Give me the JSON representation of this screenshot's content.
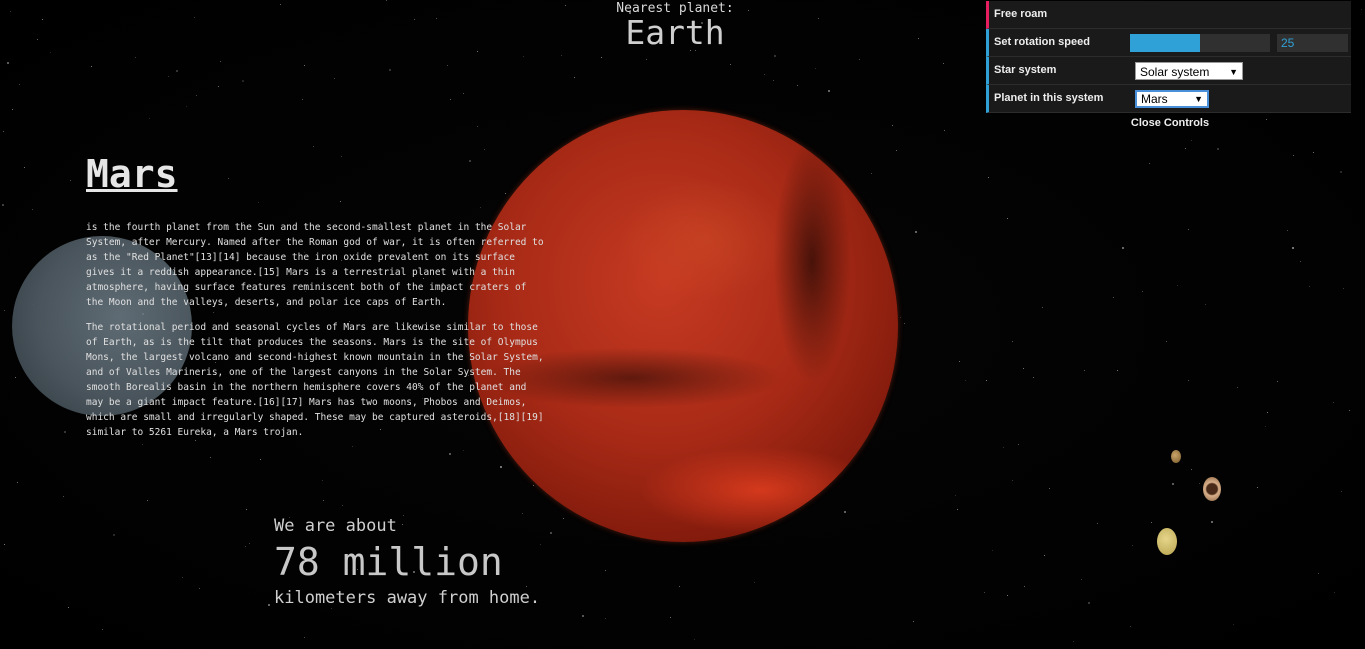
{
  "nearest": {
    "label": "Nearest planet:",
    "name": "Earth"
  },
  "planet": {
    "title": "Mars",
    "paragraphs": [
      "is the fourth planet from the Sun and the second-smallest planet in the Solar System, after Mercury. Named after the Roman god of war, it is often referred to as the \"Red Planet\"[13][14] because the iron oxide prevalent on its surface gives it a reddish appearance.[15] Mars is a terrestrial planet with a thin atmosphere, having surface features reminiscent both of the impact craters of the Moon and the valleys, deserts, and polar ice caps of Earth.",
      "The rotational period and seasonal cycles of Mars are likewise similar to those of Earth, as is the tilt that produces the seasons. Mars is the site of Olympus Mons, the largest volcano and second-highest known mountain in the Solar System, and of Valles Marineris, one of the largest canyons in the Solar System. The smooth Borealis basin in the northern hemisphere covers 40% of the planet and may be a giant impact feature.[16][17] Mars has two moons, Phobos and Deimos, which are small and irregularly shaped. These may be captured asteroids,[18][19] similar to 5261 Eureka, a Mars trojan."
    ]
  },
  "distance": {
    "prefix": "We are about",
    "amount": "78 million",
    "suffix": "kilometers away from home."
  },
  "controls": {
    "free_roam": "Free roam",
    "rotation_label": "Set rotation speed",
    "rotation_value": "25",
    "rotation_fraction": 0.5,
    "star_system_label": "Star system",
    "star_system_value": "Solar system",
    "planet_label": "Planet in this system",
    "planet_value": "Mars",
    "close": "Close Controls"
  },
  "colors": {
    "accent": "#2fa1d6",
    "free_roam_accent": "#e61d5f",
    "mars": "#a82a16"
  }
}
